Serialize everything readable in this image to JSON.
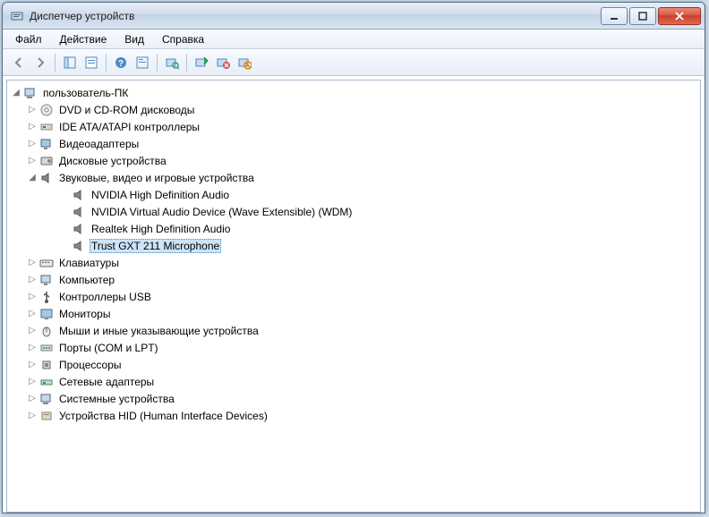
{
  "window": {
    "title": "Диспетчер устройств"
  },
  "menu": {
    "file": "Файл",
    "action": "Действие",
    "view": "Вид",
    "help": "Справка"
  },
  "tree": {
    "root": "пользователь-ПК",
    "dvd": "DVD и CD-ROM дисководы",
    "ide": "IDE ATA/ATAPI контроллеры",
    "video": "Видеоадаптеры",
    "disk": "Дисковые устройства",
    "sound": "Звуковые, видео и игровые устройства",
    "sound_children": {
      "nvidia_hd": "NVIDIA High Definition Audio",
      "nvidia_virtual": "NVIDIA Virtual Audio Device (Wave Extensible) (WDM)",
      "realtek": "Realtek High Definition Audio",
      "trust": "Trust GXT 211 Microphone"
    },
    "keyboard": "Клавиатуры",
    "computer": "Компьютер",
    "usb": "Контроллеры USB",
    "monitor": "Мониторы",
    "mouse": "Мыши и иные указывающие устройства",
    "ports": "Порты (COM и LPT)",
    "cpu": "Процессоры",
    "network": "Сетевые адаптеры",
    "system": "Системные устройства",
    "hid": "Устройства HID (Human Interface Devices)"
  }
}
